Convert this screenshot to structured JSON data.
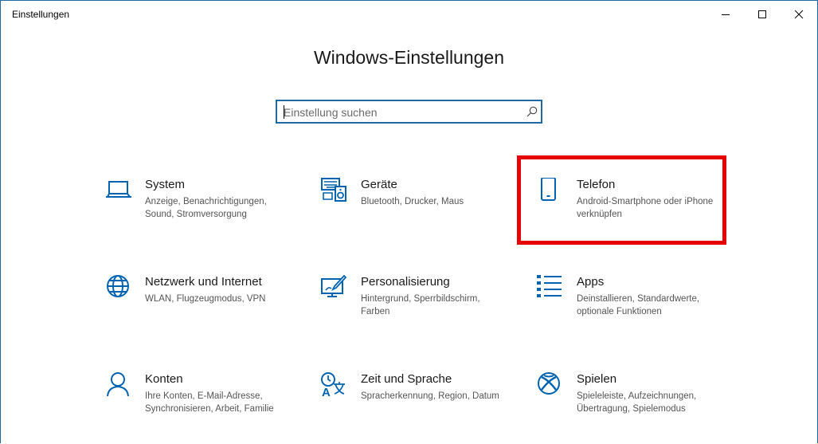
{
  "window": {
    "title": "Einstellungen"
  },
  "page": {
    "title": "Windows-Einstellungen"
  },
  "search": {
    "placeholder": "Einstellung suchen",
    "value": ""
  },
  "colors": {
    "accent": "#0063b1",
    "highlight": "#e60000"
  },
  "tiles": [
    {
      "icon": "laptop-icon",
      "title": "System",
      "description": "Anzeige, Benachrichtigungen, Sound, Stromversorgung"
    },
    {
      "icon": "devices-icon",
      "title": "Geräte",
      "description": "Bluetooth, Drucker, Maus"
    },
    {
      "icon": "phone-icon",
      "title": "Telefon",
      "description": "Android-Smartphone oder iPhone verknüpfen"
    },
    {
      "icon": "globe-icon",
      "title": "Netzwerk und Internet",
      "description": "WLAN, Flugzeugmodus, VPN"
    },
    {
      "icon": "personalization-icon",
      "title": "Personalisierung",
      "description": "Hintergrund, Sperrbildschirm, Farben"
    },
    {
      "icon": "apps-list-icon",
      "title": "Apps",
      "description": "Deinstallieren, Standardwerte, optionale Funktionen"
    },
    {
      "icon": "person-icon",
      "title": "Konten",
      "description": "Ihre Konten, E-Mail-Adresse, Synchronisieren, Arbeit, Familie"
    },
    {
      "icon": "time-language-icon",
      "title": "Zeit und Sprache",
      "description": "Spracherkennung, Region, Datum"
    },
    {
      "icon": "xbox-icon",
      "title": "Spielen",
      "description": "Spieleleiste, Aufzeichnungen, Übertragung, Spielemodus"
    }
  ]
}
